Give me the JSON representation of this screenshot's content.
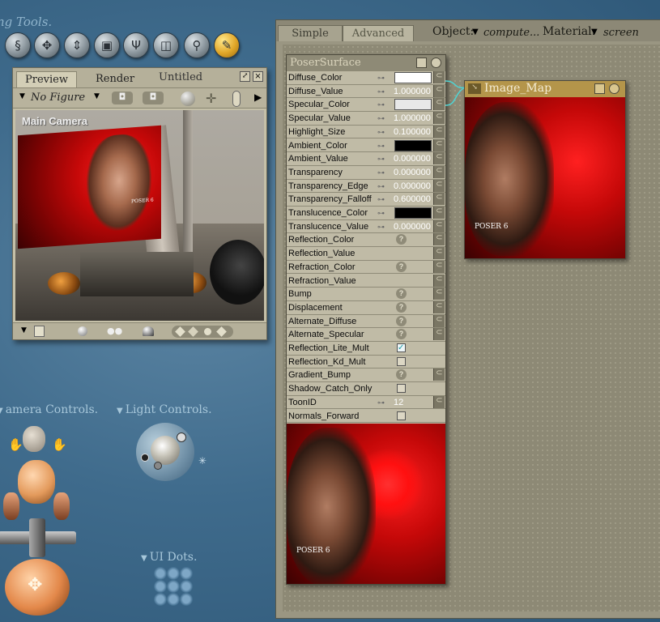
{
  "tools": {
    "label": "ng Tools.",
    "icons": [
      "spiral-icon",
      "move-icon",
      "scale-icon",
      "box-icon",
      "taper-icon",
      "frame-icon",
      "zoom-icon",
      "eyedropper-icon"
    ]
  },
  "preview": {
    "tabs": [
      "Preview",
      "Render"
    ],
    "title": "Untitled",
    "figure": "No Figure",
    "camera": "Main Camera"
  },
  "material": {
    "tabs": [
      "Simple",
      "Advanced"
    ],
    "object_label": "Object:",
    "object_value": "compute...",
    "material_label": "Material:",
    "material_value": "screen"
  },
  "surface": {
    "title": "PoserSurface",
    "rows": [
      {
        "name": "Diffuse_Color",
        "kind": "color",
        "color": "#ffffff"
      },
      {
        "name": "Diffuse_Value",
        "kind": "value",
        "value": "1.000000"
      },
      {
        "name": "Specular_Color",
        "kind": "color",
        "color": "#e8e8e8"
      },
      {
        "name": "Specular_Value",
        "kind": "value",
        "value": "1.000000"
      },
      {
        "name": "Highlight_Size",
        "kind": "value",
        "value": "0.100000"
      },
      {
        "name": "Ambient_Color",
        "kind": "color",
        "color": "#000000"
      },
      {
        "name": "Ambient_Value",
        "kind": "value",
        "value": "0.000000"
      },
      {
        "name": "Transparency",
        "kind": "value",
        "value": "0.000000"
      },
      {
        "name": "Transparency_Edge",
        "kind": "value",
        "value": "0.000000"
      },
      {
        "name": "Transparency_Falloff",
        "kind": "value",
        "value": "0.600000"
      },
      {
        "name": "Translucence_Color",
        "kind": "color",
        "color": "#000000"
      },
      {
        "name": "Translucence_Value",
        "kind": "value",
        "value": "0.000000"
      },
      {
        "name": "Reflection_Color",
        "kind": "q"
      },
      {
        "name": "Reflection_Value",
        "kind": "none"
      },
      {
        "name": "Refraction_Color",
        "kind": "q"
      },
      {
        "name": "Refraction_Value",
        "kind": "none"
      },
      {
        "name": "Bump",
        "kind": "q"
      },
      {
        "name": "Displacement",
        "kind": "q"
      },
      {
        "name": "Alternate_Diffuse",
        "kind": "q"
      },
      {
        "name": "Alternate_Specular",
        "kind": "q"
      },
      {
        "name": "Reflection_Lite_Mult",
        "kind": "check",
        "checked": true
      },
      {
        "name": "Reflection_Kd_Mult",
        "kind": "check",
        "checked": false
      },
      {
        "name": "Gradient_Bump",
        "kind": "q"
      },
      {
        "name": "Shadow_Catch_Only",
        "kind": "check",
        "checked": false
      },
      {
        "name": "ToonID",
        "kind": "value",
        "value": "12"
      },
      {
        "name": "Normals_Forward",
        "kind": "check",
        "checked": false
      }
    ]
  },
  "imagemap": {
    "title": "Image_Map"
  },
  "poster": {
    "brand": "POSER 6"
  },
  "sections": {
    "camera": "amera Controls.",
    "light": "Light Controls.",
    "uidots": "UI Dots."
  }
}
